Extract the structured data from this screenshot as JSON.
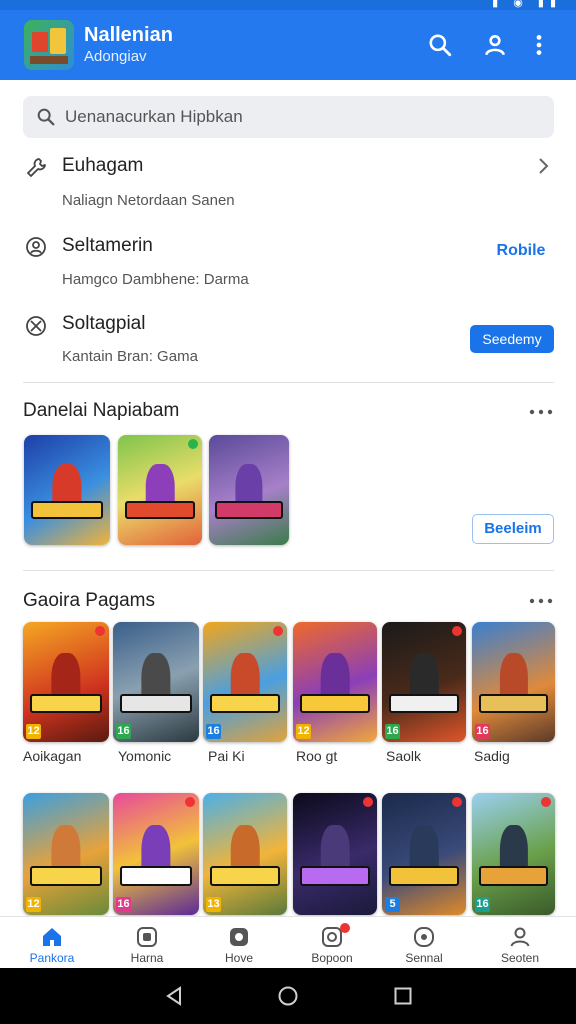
{
  "app": {
    "title": "Nallenian",
    "subtitle": "Adongiav"
  },
  "search": {
    "placeholder": "Uenanacurkan Hipbkan"
  },
  "rows": [
    {
      "title": "Euhagam",
      "subtitle": "Naliagn Netordaan Sanen"
    },
    {
      "title": "Seltamerin",
      "subtitle": "Hamgco Dambhene: Darma",
      "action": "Robile"
    },
    {
      "title": "Soltagpial",
      "subtitle": "Kantain Bran: Gama",
      "action": "Seedemy"
    }
  ],
  "section1": {
    "title": "Danelai Napiabam",
    "button": "Beeleim"
  },
  "section2": {
    "title": "Gaoira Pagams",
    "games": [
      {
        "name": "Aoikagan",
        "rating": "12"
      },
      {
        "name": "Yomonic",
        "rating": "16"
      },
      {
        "name": "Pai Ki",
        "rating": "16"
      },
      {
        "name": "Roo gt",
        "rating": "12"
      },
      {
        "name": "Saolk",
        "rating": "16"
      },
      {
        "name": "Sadig",
        "rating": "16"
      }
    ],
    "row2_ratings": [
      "12",
      "16",
      "13",
      "",
      "5",
      "16"
    ]
  },
  "bottom_nav": [
    {
      "label": "Pankora",
      "icon": "home-icon"
    },
    {
      "label": "Harna",
      "icon": "apps-icon"
    },
    {
      "label": "Hove",
      "icon": "settings-icon"
    },
    {
      "label": "Bopoon",
      "icon": "camera-icon"
    },
    {
      "label": "Sennal",
      "icon": "controller-icon"
    },
    {
      "label": "Seoten",
      "icon": "profile-icon"
    }
  ],
  "colors": {
    "accent": "#1a73e8",
    "appbar": "#2479ee"
  }
}
